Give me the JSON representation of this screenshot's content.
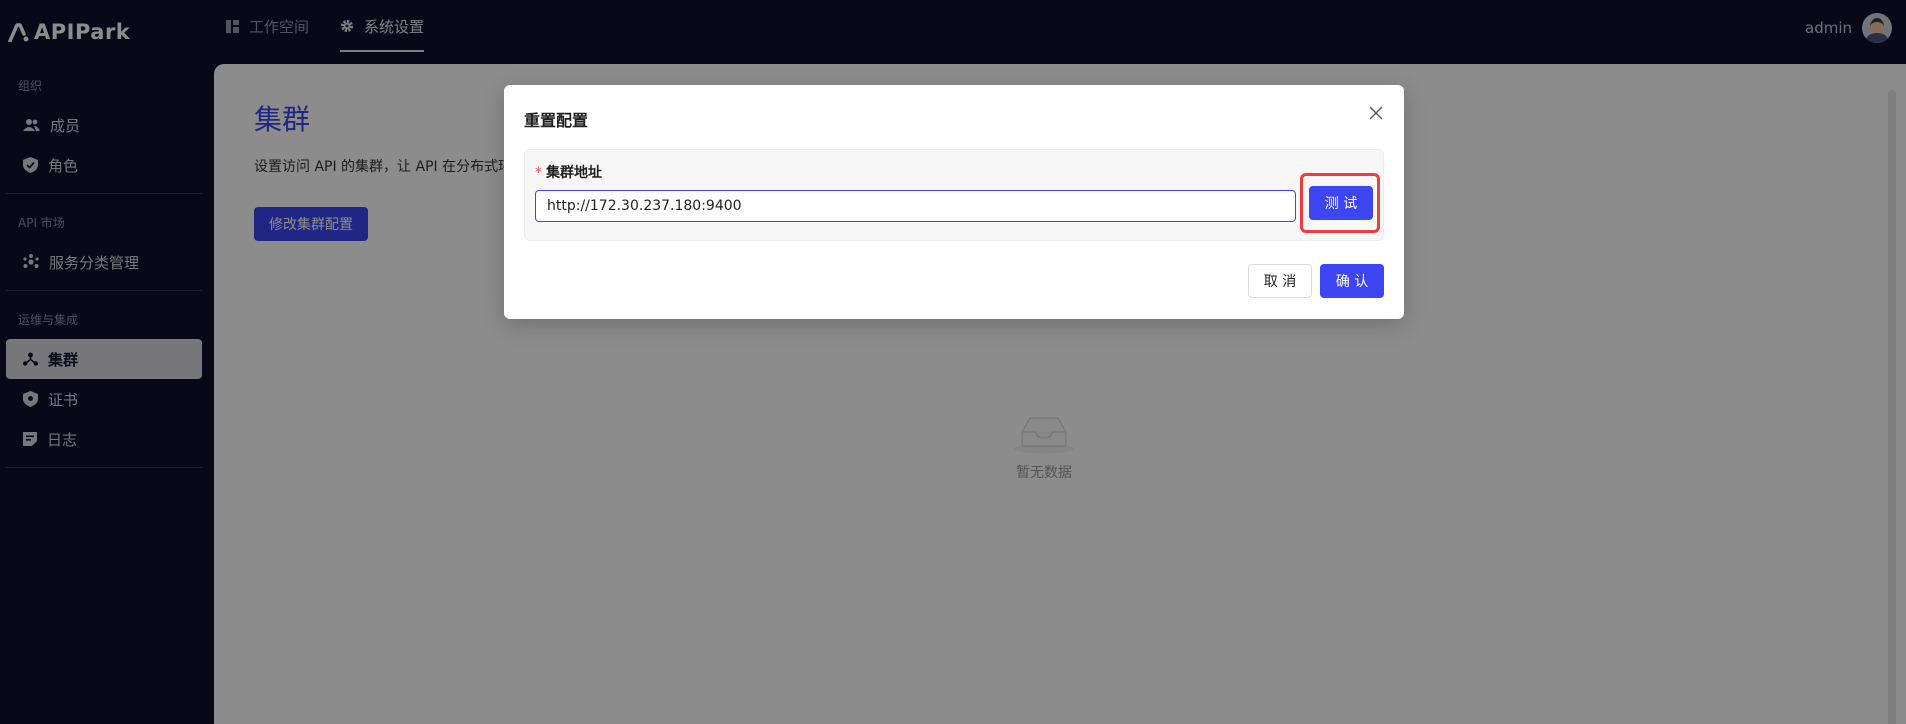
{
  "app": {
    "name": "APIPark"
  },
  "topnav": {
    "tabs": [
      {
        "label": "工作空间",
        "icon": "dashboard-icon",
        "active": false
      },
      {
        "label": "系统设置",
        "icon": "gear-icon",
        "active": true
      }
    ],
    "user": {
      "name": "admin",
      "icon": "avatar"
    }
  },
  "sidebar": {
    "groups": [
      {
        "title": "组织",
        "items": [
          {
            "label": "成员",
            "icon": "users-icon"
          },
          {
            "label": "角色",
            "icon": "shield-check-icon"
          }
        ]
      },
      {
        "title": "API 市场",
        "items": [
          {
            "label": "服务分类管理",
            "icon": "category-icon"
          }
        ]
      },
      {
        "title": "运维与集成",
        "items": [
          {
            "label": "集群",
            "icon": "cluster-icon",
            "active": true
          },
          {
            "label": "证书",
            "icon": "certificate-shield-icon"
          },
          {
            "label": "日志",
            "icon": "log-icon"
          }
        ]
      }
    ]
  },
  "main": {
    "title": "集群",
    "description": "设置访问 API 的集群，让 API 在分布式环",
    "edit_button": "修改集群配置",
    "empty_text": "暂无数据"
  },
  "modal": {
    "title": "重置配置",
    "field_required_mark": "*",
    "field_label": "集群地址",
    "field_value": "http://172.30.237.180:9400",
    "test_button": "测 试",
    "cancel_button": "取 消",
    "confirm_button": "确 认"
  },
  "colors": {
    "primary": "#3d46f2",
    "nav_bg": "#0f0f2e",
    "highlight": "#e8403a"
  }
}
